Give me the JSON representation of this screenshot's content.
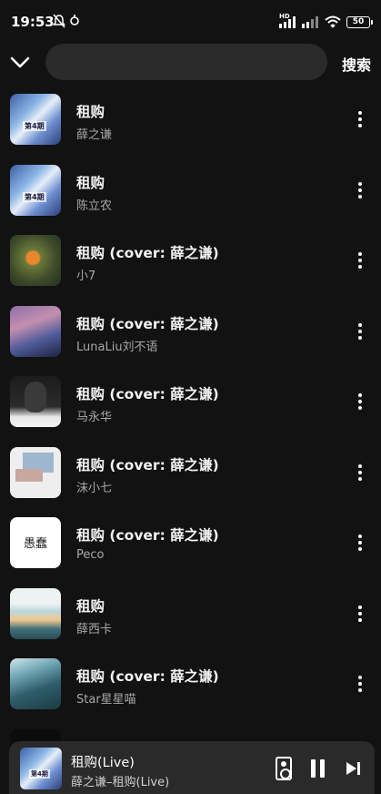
{
  "status_bar": {
    "time": "19:53",
    "hd_label": "HD",
    "battery": "50"
  },
  "header": {
    "search_placeholder": "",
    "search_label": "搜索"
  },
  "results": [
    {
      "title": "租购",
      "artist": "薛之谦",
      "cover": "c1"
    },
    {
      "title": "租购",
      "artist": "陈立农",
      "cover": "c1"
    },
    {
      "title": "租购 (cover: 薛之谦)",
      "artist": "小7",
      "cover": "c3"
    },
    {
      "title": "租购 (cover: 薛之谦)",
      "artist": "LunaLiu刘不语",
      "cover": "c4"
    },
    {
      "title": "租购 (cover: 薛之谦)",
      "artist": "马永华",
      "cover": "c5"
    },
    {
      "title": "租购 (cover: 薛之谦)",
      "artist": "沫小七",
      "cover": "c6"
    },
    {
      "title": "租购 (cover: 薛之谦)",
      "artist": "Peco",
      "cover": "c7"
    },
    {
      "title": "租购",
      "artist": "薛西卡",
      "cover": "c8"
    },
    {
      "title": "租购 (cover: 薛之谦)",
      "artist": "Star星星喵",
      "cover": "c9"
    }
  ],
  "cover_text": {
    "c1": "第4期",
    "c7": "愚蠢"
  },
  "player": {
    "title": "租购(Live)",
    "subtitle": "薛之谦–租购(Live)"
  },
  "icons": {
    "back": "chevron-down-icon",
    "more": "more-vertical-icon",
    "speaker": "speaker-device-icon",
    "pause": "pause-icon",
    "next": "skip-next-icon"
  }
}
